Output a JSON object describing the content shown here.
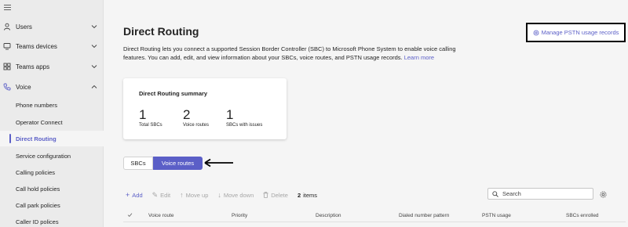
{
  "sidebar": {
    "top_items": [
      {
        "label": "Users",
        "icon": "user-icon"
      },
      {
        "label": "Teams devices",
        "icon": "device-icon"
      },
      {
        "label": "Teams apps",
        "icon": "apps-icon"
      },
      {
        "label": "Voice",
        "icon": "phone-icon"
      }
    ],
    "voice_subitems": [
      {
        "label": "Phone numbers"
      },
      {
        "label": "Operator Connect"
      },
      {
        "label": "Direct Routing",
        "active": true
      },
      {
        "label": "Service configuration"
      },
      {
        "label": "Calling policies"
      },
      {
        "label": "Call hold policies"
      },
      {
        "label": "Call park policies"
      },
      {
        "label": "Caller ID polices"
      }
    ]
  },
  "page": {
    "title": "Direct Routing",
    "description": "Direct Routing lets you connect a supported Session Border Controller (SBC) to Microsoft Phone System to enable voice calling features. You can add, edit, and view information about your SBCs, voice routes, and PSTN usage records.",
    "learn_more": "Learn more",
    "manage_link": "Manage PSTN usage records"
  },
  "summary": {
    "title": "Direct Routing summary",
    "stats": [
      {
        "value": "1",
        "label": "Total SBCs"
      },
      {
        "value": "2",
        "label": "Voice routes"
      },
      {
        "value": "1",
        "label": "SBCs with issues"
      }
    ]
  },
  "tabs": [
    {
      "label": "SBCs",
      "selected": false
    },
    {
      "label": "Voice routes",
      "selected": true
    }
  ],
  "toolbar": {
    "add": "Add",
    "edit": "Edit",
    "move_up": "Move up",
    "move_down": "Move down",
    "delete": "Delete",
    "item_count": "2",
    "items_word": "items"
  },
  "search": {
    "placeholder": "Search",
    "value": ""
  },
  "table": {
    "columns": [
      "Voice route",
      "Priority",
      "Description",
      "Dialed number pattern",
      "PSTN usage",
      "SBCs enrolled"
    ]
  },
  "colors": {
    "accent": "#5b5fc7",
    "sidebar_bg": "#ebebeb",
    "page_bg": "#f5f5f5"
  }
}
